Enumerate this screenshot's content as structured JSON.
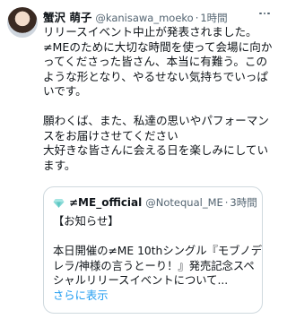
{
  "tweet": {
    "display_name": "蟹沢 萌子",
    "handle": "@kanisawa_moeko",
    "separator": "·",
    "time": "1時間",
    "lines": [
      "リリースイベント中止が発表されました。",
      "≠MEのために大切な時間を使って会場に向か",
      "ってくださった皆さん、本当に有難う。この",
      "ような形となり、やるせない気持ちでいっぱ",
      "いです。",
      "",
      "願わくば、また、私達の思いやパフォーマン",
      "スをお届けさせてください",
      "大好きな皆さんに会える日を楽しみにしてい",
      "ます。"
    ]
  },
  "quote": {
    "icon": "diamond-icon",
    "display_name": "≠ME_official",
    "handle": "@Notequal_ME",
    "separator": "·",
    "time": "3時間",
    "lines": [
      "【お知らせ】",
      "",
      "本日開催の≠ME 10thシングル『モブノデ",
      "レラ/神様の言うとーり！』発売記念スペ",
      "シャルリリースイベントについて..."
    ],
    "show_more": "さらに表示"
  },
  "colors": {
    "text": "#0f1419",
    "secondary": "#536471",
    "link": "#1d9bf0",
    "border": "#cfd9de"
  }
}
